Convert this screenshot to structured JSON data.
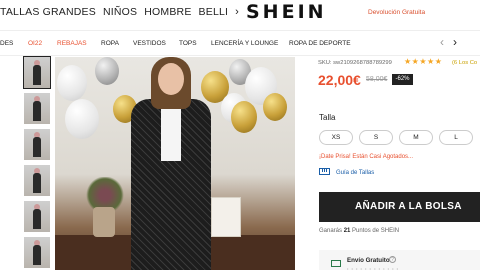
{
  "header": {
    "nav_items": [
      "TALLAS GRANDES",
      "NIÑOS",
      "HOMBRE",
      "BELLI"
    ],
    "nav_next_icon": "chevron-right-icon",
    "logo": "SHEIN",
    "promo": "Devolución Gratuita"
  },
  "categories": {
    "items": [
      "DES",
      "OI22",
      "REBAJAS",
      "ROPA",
      "VESTIDOS",
      "TOPS",
      "LENCERÍA Y LOUNGE",
      "ROPA DE DEPORTE"
    ],
    "highlighted": [
      "OI22",
      "REBAJAS"
    ],
    "prev_icon": "chevron-left-icon",
    "next_icon": "chevron-right-icon"
  },
  "gallery": {
    "thumbnail_count": 6,
    "active_index": 0
  },
  "product": {
    "sku": "SKU: sw2109268788789299",
    "rating_stars": "★★★★★",
    "rating_value": 5,
    "reviews_link": "(6 Los Co",
    "price": "22,00€",
    "old_price": "58,00€",
    "discount": "-62%"
  },
  "size": {
    "label": "Talla",
    "options": [
      "XS",
      "S",
      "M",
      "L"
    ],
    "alert": "¡Date Prisa! Están Casi Agotados...",
    "guide": "Guía de Tallas"
  },
  "actions": {
    "add_to_bag": "AÑADIR A LA BOLSA",
    "points_prefix": "Ganarás ",
    "points_value": "21",
    "points_suffix": " Puntos de SHEIN"
  },
  "shipping": {
    "title": "Envío Gratuito",
    "info_icon": "question-icon",
    "truck_icon": "truck-icon"
  },
  "colors": {
    "accent": "#e8502f",
    "link": "#1a5ea8",
    "dark": "#222222",
    "stars": "#f5a623"
  }
}
